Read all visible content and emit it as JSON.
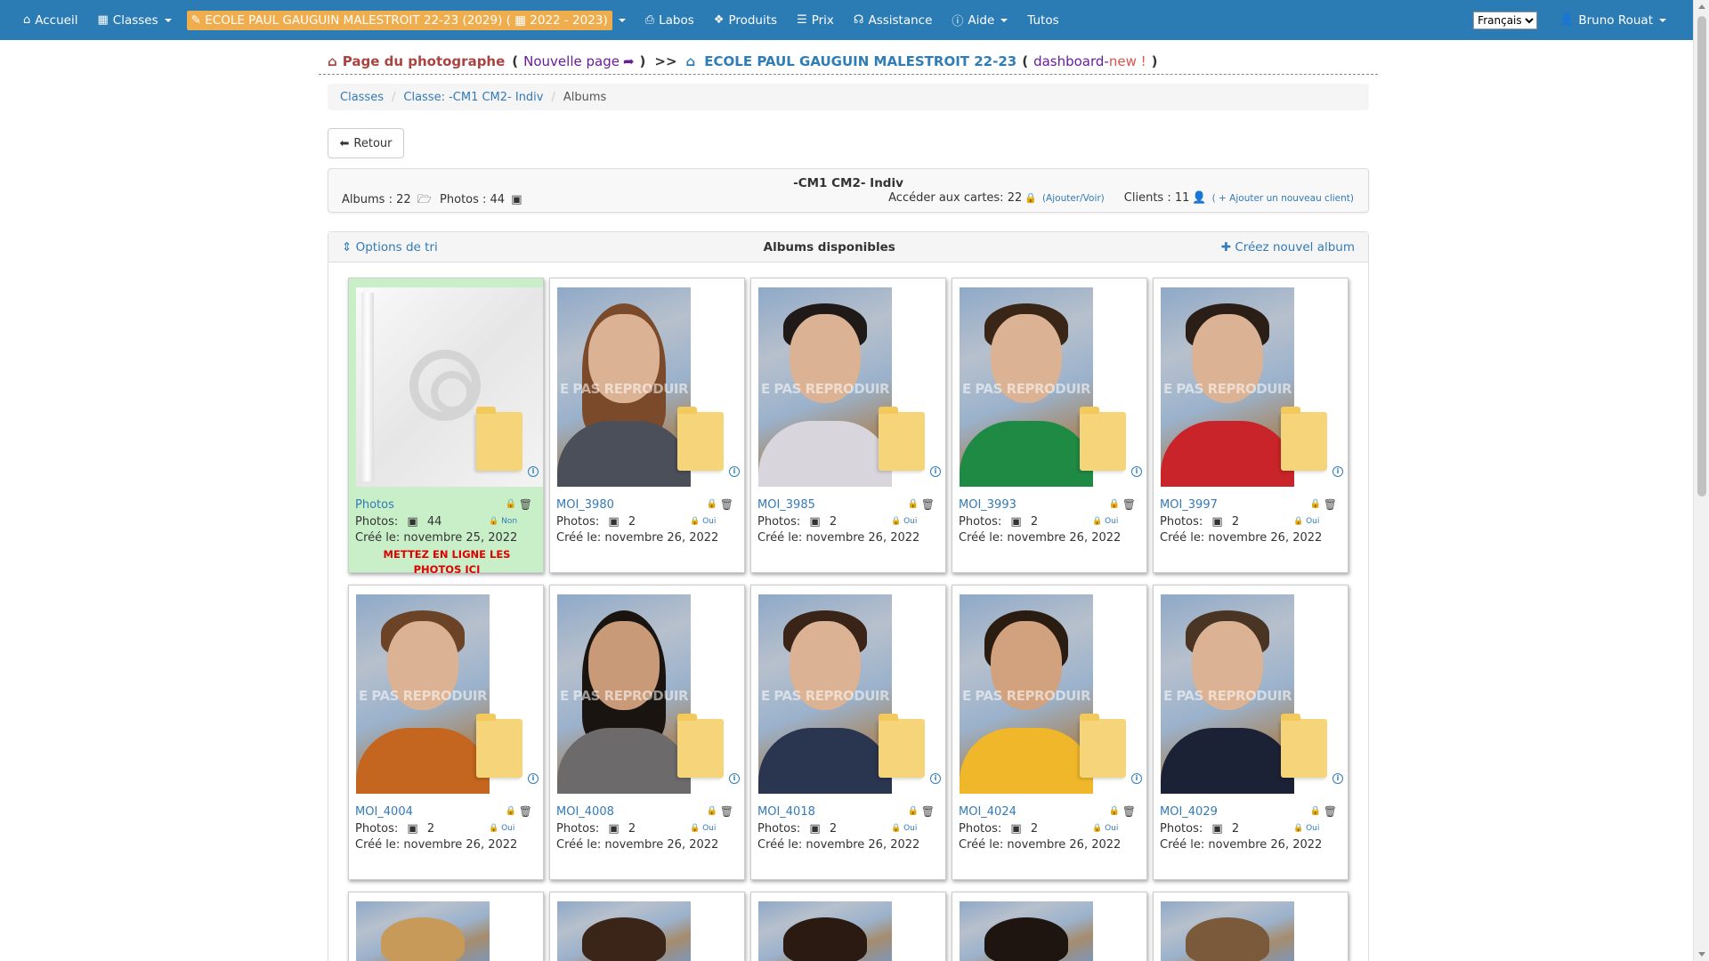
{
  "nav": {
    "home": "Accueil",
    "classes": "Classes",
    "school": "ECOLE PAUL GAUGUIN MALESTROIT 22-23 (2029) (",
    "school_year": "2022 - 2023)",
    "labos": "Labos",
    "produits": "Produits",
    "prix": "Prix",
    "assistance": "Assistance",
    "aide": "Aide",
    "tutos": "Tutos",
    "language": "Français",
    "user": "Bruno Rouat"
  },
  "header": {
    "photographer_page": "Page du photographe",
    "open_paren": "(",
    "new_page": "Nouvelle page",
    "close_paren": ")",
    "arrows": ">>",
    "school_name": "ECOLE PAUL GAUGUIN MALESTROIT 22-23",
    "open_paren2": "(",
    "dashboard": "dashboard-",
    "dashboard_new": "new !",
    "close_paren2": ")"
  },
  "breadcrumb": {
    "item1": "Classes",
    "item2": "Classe: -CM1 CM2- Indiv",
    "item3": "Albums",
    "sep": "/"
  },
  "back_button": "Retour",
  "info": {
    "class_name": "-CM1 CM2- Indiv",
    "albums_label": "Albums : 22",
    "photos_label": "Photos : 44",
    "cards_label": "Accéder aux cartes: 22",
    "cards_link": "(Ajouter/Voir)",
    "clients_label": "Clients : 11",
    "clients_link": "( + Ajouter un nouveau client)"
  },
  "albums_panel": {
    "sort_options": "Options de tri",
    "title": "Albums disponibles",
    "create": "Créez nouvel album"
  },
  "card_labels": {
    "photos": "Photos:",
    "created": "Créé le:"
  },
  "albums": [
    {
      "name": "Photos",
      "count": "44",
      "flag": "Non",
      "date": "novembre 25, 2022",
      "note": "METTEZ EN LIGNE LES PHOTOS ICI"
    },
    {
      "name": "MOI_3980",
      "count": "2",
      "flag": "Oui",
      "date": "novembre 26, 2022"
    },
    {
      "name": "MOI_3985",
      "count": "2",
      "flag": "Oui",
      "date": "novembre 26, 2022"
    },
    {
      "name": "MOI_3993",
      "count": "2",
      "flag": "Oui",
      "date": "novembre 26, 2022"
    },
    {
      "name": "MOI_3997",
      "count": "2",
      "flag": "Oui",
      "date": "novembre 26, 2022"
    },
    {
      "name": "MOI_4004",
      "count": "2",
      "flag": "Oui",
      "date": "novembre 26, 2022"
    },
    {
      "name": "MOI_4008",
      "count": "2",
      "flag": "Oui",
      "date": "novembre 26, 2022"
    },
    {
      "name": "MOI_4018",
      "count": "2",
      "flag": "Oui",
      "date": "novembre 26, 2022"
    },
    {
      "name": "MOI_4024",
      "count": "2",
      "flag": "Oui",
      "date": "novembre 26, 2022"
    },
    {
      "name": "MOI_4029",
      "count": "2",
      "flag": "Oui",
      "date": "novembre 26, 2022"
    }
  ],
  "watermark": "E PAS REPRODUIR",
  "colors": {
    "navbar": "#2b7bb5",
    "school_badge": "#f0ad4e",
    "highlight_card": "#c8efc8",
    "link": "#337ab7",
    "warning_text": "#e00000"
  }
}
